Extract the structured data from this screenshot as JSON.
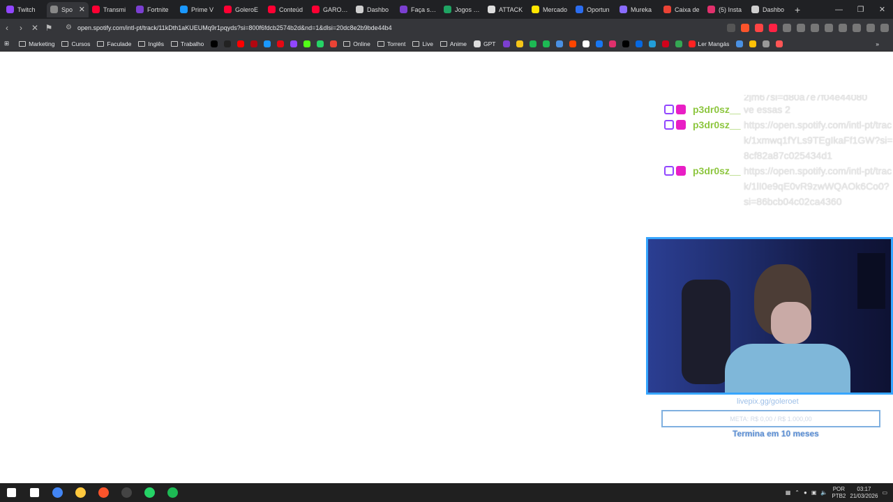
{
  "tabs": [
    {
      "label": "Twitch",
      "color": "#9146ff"
    },
    {
      "label": "Spo",
      "color": "#888888",
      "active": true
    },
    {
      "label": "Transmi",
      "color": "#ff0033"
    },
    {
      "label": "Fortnite",
      "color": "#7b3fd1"
    },
    {
      "label": "Prime V",
      "color": "#1a98ff"
    },
    {
      "label": "GoleroE",
      "color": "#ff0033"
    },
    {
      "label": "Conteúd",
      "color": "#ff0033"
    },
    {
      "label": "GAROTA",
      "color": "#ff0033"
    },
    {
      "label": "Dashbo",
      "color": "#cfcfcf"
    },
    {
      "label": "Faça seu",
      "color": "#7b3fd1"
    },
    {
      "label": "Jogos Ze",
      "color": "#1fa463"
    },
    {
      "label": "ATTACK",
      "color": "#dddddd"
    },
    {
      "label": "Mercado",
      "color": "#ffe600"
    },
    {
      "label": "Oportun",
      "color": "#2b6df0"
    },
    {
      "label": "Mureka",
      "color": "#8a6cff"
    },
    {
      "label": "Caixa de",
      "color": "#ea4335"
    },
    {
      "label": "(5) Insta",
      "color": "#e1306c"
    },
    {
      "label": "Dashbo",
      "color": "#cfcfcf"
    }
  ],
  "url": "open.spotify.com/intl-pt/track/11kDth1aKUEUMq9r1pqyds?si=800f6fdcb2574b2d&nd=1&dlsi=20dc8e2b9bde44b4",
  "bookmarks": [
    {
      "label": "Marketing",
      "type": "folder"
    },
    {
      "label": "Cursos",
      "type": "folder"
    },
    {
      "label": "Faculade",
      "type": "folder"
    },
    {
      "label": "Inglês",
      "type": "folder"
    },
    {
      "label": "Trabalho",
      "type": "folder"
    },
    {
      "color": "#000000",
      "type": "icon"
    },
    {
      "color": "#222222",
      "type": "icon"
    },
    {
      "color": "#ff0000",
      "type": "icon"
    },
    {
      "color": "#b20710",
      "type": "icon"
    },
    {
      "color": "#1a98ff",
      "type": "icon"
    },
    {
      "color": "#e50914",
      "type": "icon"
    },
    {
      "color": "#9146ff",
      "type": "icon"
    },
    {
      "color": "#53fc18",
      "type": "icon"
    },
    {
      "color": "#25d366",
      "type": "icon"
    },
    {
      "color": "#ea4335",
      "type": "icon"
    },
    {
      "label": "Online",
      "type": "folder"
    },
    {
      "label": "Torrent",
      "type": "folder"
    },
    {
      "label": "Live",
      "type": "folder"
    },
    {
      "label": "Anime",
      "type": "folder"
    },
    {
      "label": "GPT",
      "type": "icon-label",
      "color": "#dddddd"
    },
    {
      "color": "#7b3fd1",
      "type": "icon"
    },
    {
      "color": "#f5c518",
      "type": "icon"
    },
    {
      "color": "#1db954",
      "type": "icon"
    },
    {
      "color": "#1db954",
      "type": "icon"
    },
    {
      "color": "#4a90e2",
      "type": "icon"
    },
    {
      "color": "#ff4500",
      "type": "icon"
    },
    {
      "color": "#ffffff",
      "type": "icon"
    },
    {
      "color": "#1877f2",
      "type": "icon"
    },
    {
      "color": "#e1306c",
      "type": "icon"
    },
    {
      "color": "#000000",
      "type": "icon"
    },
    {
      "color": "#0668e1",
      "type": "icon"
    },
    {
      "color": "#229ed9",
      "type": "icon"
    },
    {
      "color": "#d0021b",
      "type": "icon"
    },
    {
      "color": "#34a853",
      "type": "icon"
    },
    {
      "label": "Ler Mangás",
      "type": "icon-label",
      "color": "#ff2222"
    },
    {
      "color": "#4a90e2",
      "type": "icon"
    },
    {
      "color": "#ffc107",
      "type": "icon"
    },
    {
      "color": "#999999",
      "type": "icon"
    },
    {
      "color": "#ff5555",
      "type": "icon"
    }
  ],
  "chat": {
    "partial_top": "2jm67si=d80a7e7f04e44080",
    "messages": [
      {
        "user": "p3dr0sz__",
        "text": "ve essas 2"
      },
      {
        "user": "p3dr0sz__",
        "text": "https://open.spotify.com/intl-pt/track/1xmwq1fYLs9TEgIkaFf1GW?si=8cf82a87c025434d1"
      },
      {
        "user": "p3dr0sz__",
        "text": "https://open.spotify.com/intl-pt/track/1lI0e9qE0vR9zwWQAOk6Co0?si=86bcb04c02ca4360"
      }
    ]
  },
  "overlay": {
    "donate_link": "livepix.gg/goleroet",
    "goal_text": "META: R$ 0,00 / R$ 1.000,00",
    "subs_expire": "Termina em 10 meses"
  },
  "taskbar": {
    "apps": [
      {
        "name": "windows-start",
        "color": "#ffffff"
      },
      {
        "name": "search",
        "color": "#ffffff"
      },
      {
        "name": "chrome",
        "color": "#4285f4"
      },
      {
        "name": "explorer",
        "color": "#ffc83d"
      },
      {
        "name": "brave",
        "color": "#fb542b"
      },
      {
        "name": "obs",
        "color": "#444444"
      },
      {
        "name": "whatsapp",
        "color": "#25d366"
      },
      {
        "name": "spotify",
        "color": "#1db954"
      }
    ],
    "lang_top": "POR",
    "lang_bottom": "PTB2",
    "time": "03:17",
    "date": "21/03/2026"
  }
}
